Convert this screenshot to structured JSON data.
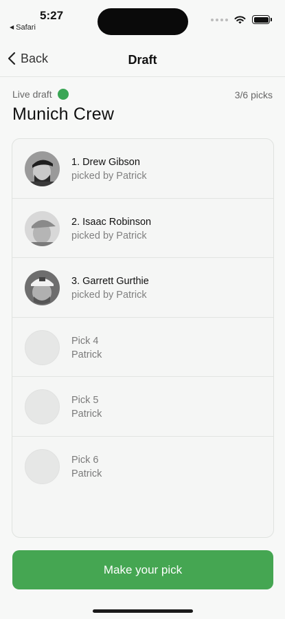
{
  "status_bar": {
    "time": "5:27",
    "back_app": "Safari"
  },
  "nav": {
    "back_label": "Back",
    "title": "Draft"
  },
  "header": {
    "live_label": "Live draft",
    "picks_count": "3/6 picks",
    "group_name": "Munich Crew"
  },
  "picks": [
    {
      "title": "1. Drew Gibson",
      "subtitle": "picked by Patrick",
      "avatar": "photo"
    },
    {
      "title": "2. Isaac Robinson",
      "subtitle": "picked by Patrick",
      "avatar": "photo"
    },
    {
      "title": "3. Garrett Gurthie",
      "subtitle": "picked by Patrick",
      "avatar": "photo"
    },
    {
      "title": "Pick 4",
      "subtitle": "Patrick",
      "avatar": "empty"
    },
    {
      "title": "Pick 5",
      "subtitle": "Patrick",
      "avatar": "empty"
    },
    {
      "title": "Pick 6",
      "subtitle": "Patrick",
      "avatar": "empty"
    }
  ],
  "action": {
    "label": "Make your pick"
  },
  "colors": {
    "accent_green": "#45a652",
    "live_dot": "#3aa655"
  },
  "icons": {
    "back": "chevron-left-icon",
    "wifi": "wifi-icon",
    "battery": "battery-icon",
    "signal": "cellular-signal-icon"
  }
}
